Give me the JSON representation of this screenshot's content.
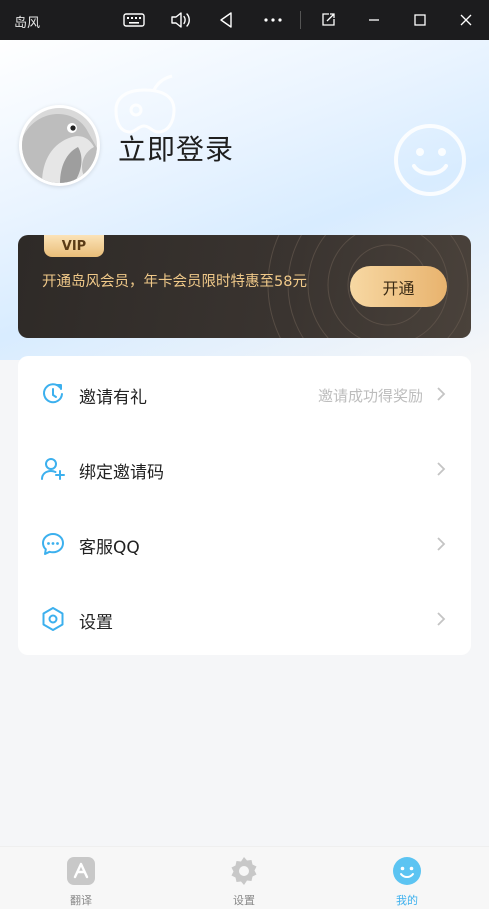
{
  "window": {
    "title": "岛风",
    "controls": [
      "keyboard-icon",
      "volume-icon",
      "back-icon",
      "more-icon",
      "resize-icon",
      "minimize-icon",
      "maximize-icon",
      "close-icon"
    ]
  },
  "header": {
    "login_text": "立即登录"
  },
  "vip": {
    "badge": "VIP",
    "promo_text": "开通岛风会员，年卡会员限时特惠至58元",
    "button_label": "开通"
  },
  "menu": {
    "items": [
      {
        "label": "邀请有礼",
        "sub": "邀请成功得奖励",
        "icon": "invite-icon"
      },
      {
        "label": "绑定邀请码",
        "sub": "",
        "icon": "add-user-icon"
      },
      {
        "label": "客服QQ",
        "sub": "",
        "icon": "chat-icon"
      },
      {
        "label": "设置",
        "sub": "",
        "icon": "settings-icon"
      }
    ]
  },
  "bottom_nav": {
    "items": [
      {
        "label": "翻译",
        "icon": "translate-icon",
        "active": false
      },
      {
        "label": "设置",
        "icon": "settings-icon",
        "active": false
      },
      {
        "label": "我的",
        "icon": "profile-icon",
        "active": true
      }
    ]
  },
  "colors": {
    "accent": "#3cb0ee",
    "vip_gold": "#f0c989",
    "vip_bg": "#2e2a27"
  }
}
